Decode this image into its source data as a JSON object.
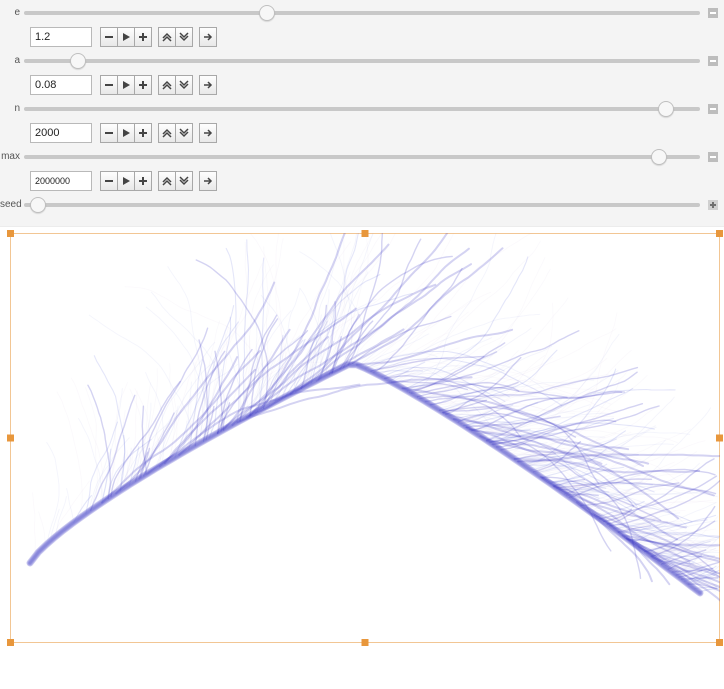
{
  "controls": {
    "e": {
      "label": "e",
      "value": "1.2",
      "slider_pos": 0.36,
      "expanded": true
    },
    "a": {
      "label": "a",
      "value": "0.08",
      "slider_pos": 0.08,
      "expanded": true
    },
    "n": {
      "label": "n",
      "value": "2000",
      "slider_pos": 0.95,
      "expanded": true
    },
    "max": {
      "label": "max",
      "value": "2000000",
      "slider_pos": 0.94,
      "expanded": true
    },
    "seed": {
      "label": "seed",
      "value": "",
      "slider_pos": 0.02,
      "expanded": false
    }
  },
  "button_icons": {
    "minus": "minus-icon",
    "play": "play-icon",
    "plus": "plus-icon",
    "up": "chevron-up-icon",
    "down": "chevron-down-icon",
    "right": "arrow-right-icon"
  },
  "selection_color": "#e8973c",
  "plot": {
    "stroke_main": "#3a36c4",
    "stroke_mid": "#5a63d8",
    "stroke_light": "#9aa6e8",
    "stroke_faint": "#b9b0d8",
    "bg": "#ffffff"
  }
}
